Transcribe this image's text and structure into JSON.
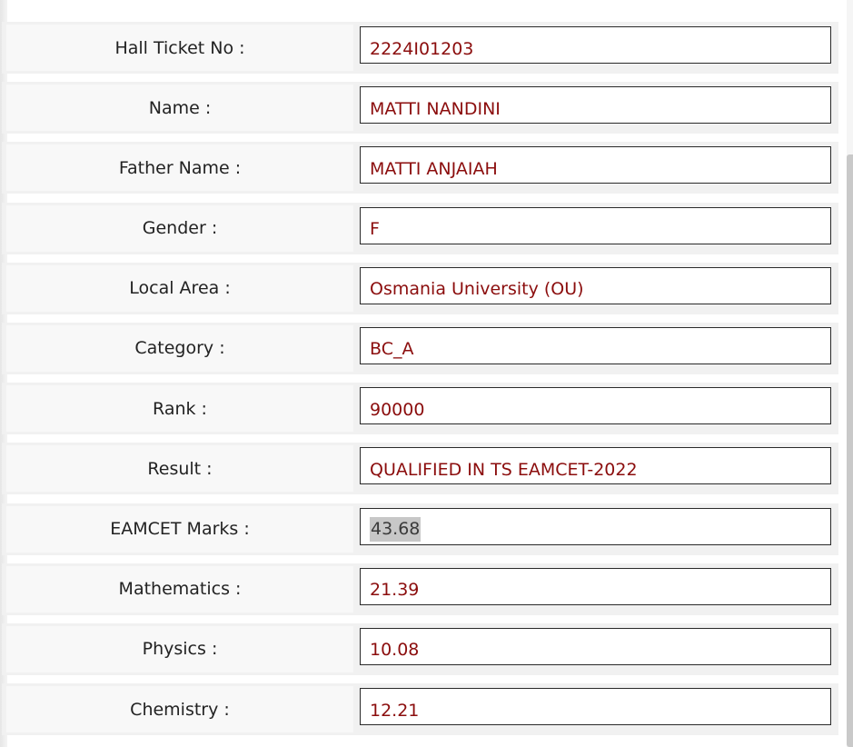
{
  "fields": [
    {
      "label": "Hall Ticket No :",
      "value": "2224I01203"
    },
    {
      "label": "Name :",
      "value": "MATTI NANDINI"
    },
    {
      "label": "Father Name :",
      "value": "MATTI ANJAIAH"
    },
    {
      "label": "Gender :",
      "value": "F"
    },
    {
      "label": "Local Area :",
      "value": "Osmania University (OU)"
    },
    {
      "label": "Category :",
      "value": "BC_A"
    },
    {
      "label": "Rank :",
      "value": "90000"
    },
    {
      "label": "Result :",
      "value": "QUALIFIED IN TS EAMCET-2022"
    },
    {
      "label": "EAMCET Marks :",
      "value": "43.68"
    },
    {
      "label": "Mathematics :",
      "value": "21.39"
    },
    {
      "label": "Physics :",
      "value": "10.08"
    },
    {
      "label": "Chemistry :",
      "value": "12.21"
    }
  ],
  "colors": {
    "value_text": "#8b0d0d",
    "label_text": "#222222",
    "row_bg": "#f1f1f1",
    "highlight_bg": "#c7c7c7"
  }
}
